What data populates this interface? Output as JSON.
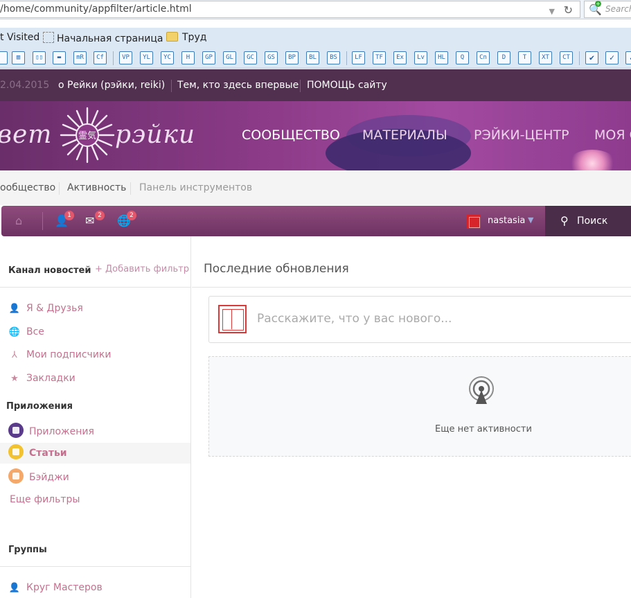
{
  "browser": {
    "url": "/home/community/appfilter/article.html",
    "search_placeholder": "Search",
    "bookmarks": [
      {
        "label": "t Visited",
        "icon": "none"
      },
      {
        "label": "Начальная страница",
        "icon": "dashed-page-icon"
      },
      {
        "label": "Труд",
        "icon": "folder-icon"
      }
    ],
    "toolbar_buttons": [
      "mR",
      "Cf",
      "VP",
      "YL",
      "YC",
      "H",
      "GP",
      "GL",
      "GC",
      "GS",
      "BP",
      "BL",
      "BS",
      "LF",
      "TF",
      "Ex",
      "Lv",
      "HL",
      "Q",
      "Cn",
      "D",
      "T",
      "XT",
      "CT"
    ]
  },
  "topbar": {
    "date": "2.04.2015",
    "links": [
      "о Рейки (рэйки, reiki)",
      "Тем, кто здесь впервые",
      "ПОМОЩЬ сайту"
    ]
  },
  "header": {
    "logo_left": "вет",
    "logo_right": "рэйки",
    "nav": [
      "СООБЩЕСТВО",
      "МАТЕРИАЛЫ",
      "РЭЙКИ-ЦЕНТР",
      "МОЯ С"
    ]
  },
  "breadcrumb": [
    "ообщество",
    "Активность",
    "Панель инструментов"
  ],
  "esbar": {
    "friends_badge": "1",
    "messages_badge": "2",
    "notifications_badge": "2",
    "username": "nastasia",
    "search_label": "Поиск"
  },
  "sidebar": {
    "news_title": "Канал новостей",
    "add_filter": "+ Добавить фильтр",
    "filters": [
      {
        "label": "Я & Друзья",
        "icon": "user-icon"
      },
      {
        "label": "Все",
        "icon": "globe-icon"
      },
      {
        "label": "Мои подписчики",
        "icon": "network-icon"
      },
      {
        "label": "Закладки",
        "icon": "star-icon"
      }
    ],
    "apps_title": "Приложения",
    "apps": [
      {
        "label": "Приложения",
        "color": "#5a3a8a"
      },
      {
        "label": "Статьи",
        "color": "#f2c230"
      },
      {
        "label": "Бэйджи",
        "color": "#f4a86a"
      }
    ],
    "more_filters": "Еще фильтры",
    "groups_title": "Группы",
    "groups": [
      {
        "label": "Круг Мастеров",
        "icon": "user-icon"
      }
    ]
  },
  "main": {
    "title": "Последние обновления",
    "status_placeholder": "Расскажите, что у вас нового...",
    "empty_message": "Еще нет активности"
  }
}
